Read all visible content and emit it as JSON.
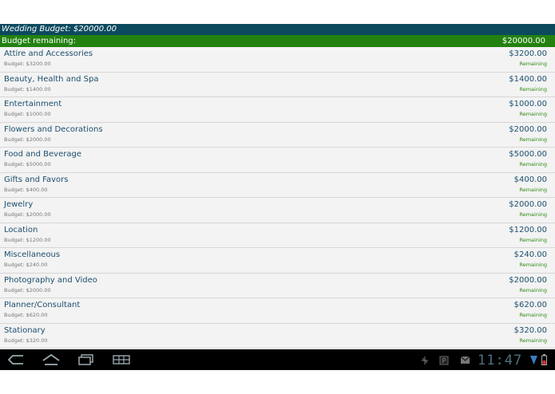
{
  "header": {
    "title": "Wedding Budget: $20000.00",
    "remaining_label": "Budget remaining:",
    "remaining_value": "$20000.00"
  },
  "categories": [
    {
      "name": "Attire and Accessories",
      "budget": "Budget: $3200.00",
      "amount": "$3200.00",
      "status": "Remaining"
    },
    {
      "name": "Beauty, Health and Spa",
      "budget": "Budget: $1400.00",
      "amount": "$1400.00",
      "status": "Remaining"
    },
    {
      "name": "Entertainment",
      "budget": "Budget: $1000.00",
      "amount": "$1000.00",
      "status": "Remaining"
    },
    {
      "name": "Flowers and Decorations",
      "budget": "Budget: $2000.00",
      "amount": "$2000.00",
      "status": "Remaining"
    },
    {
      "name": "Food and Beverage",
      "budget": "Budget: $5000.00",
      "amount": "$5000.00",
      "status": "Remaining"
    },
    {
      "name": "Gifts and Favors",
      "budget": "Budget: $400.00",
      "amount": "$400.00",
      "status": "Remaining"
    },
    {
      "name": "Jewelry",
      "budget": "Budget: $2000.00",
      "amount": "$2000.00",
      "status": "Remaining"
    },
    {
      "name": "Location",
      "budget": "Budget: $1200.00",
      "amount": "$1200.00",
      "status": "Remaining"
    },
    {
      "name": "Miscellaneous",
      "budget": "Budget: $240.00",
      "amount": "$240.00",
      "status": "Remaining"
    },
    {
      "name": "Photography and Video",
      "budget": "Budget: $2000.00",
      "amount": "$2000.00",
      "status": "Remaining"
    },
    {
      "name": "Planner/Consultant",
      "budget": "Budget: $620.00",
      "amount": "$620.00",
      "status": "Remaining"
    },
    {
      "name": "Stationary",
      "budget": "Budget: $320.00",
      "amount": "$320.00",
      "status": "Remaining"
    }
  ],
  "system_bar": {
    "time": "11:47",
    "nav_icons": [
      "back-icon",
      "home-icon",
      "recent-apps-icon",
      "menu-icon"
    ],
    "status_icons": [
      "usb-debug-icon",
      "parking-icon",
      "mail-icon",
      "signal-icon",
      "battery-icon"
    ]
  },
  "colors": {
    "title_bar": "#0c4a5e",
    "remaining_bar": "#23820f",
    "category_text": "#1d4f6e",
    "remaining_text": "#2e8a12"
  }
}
